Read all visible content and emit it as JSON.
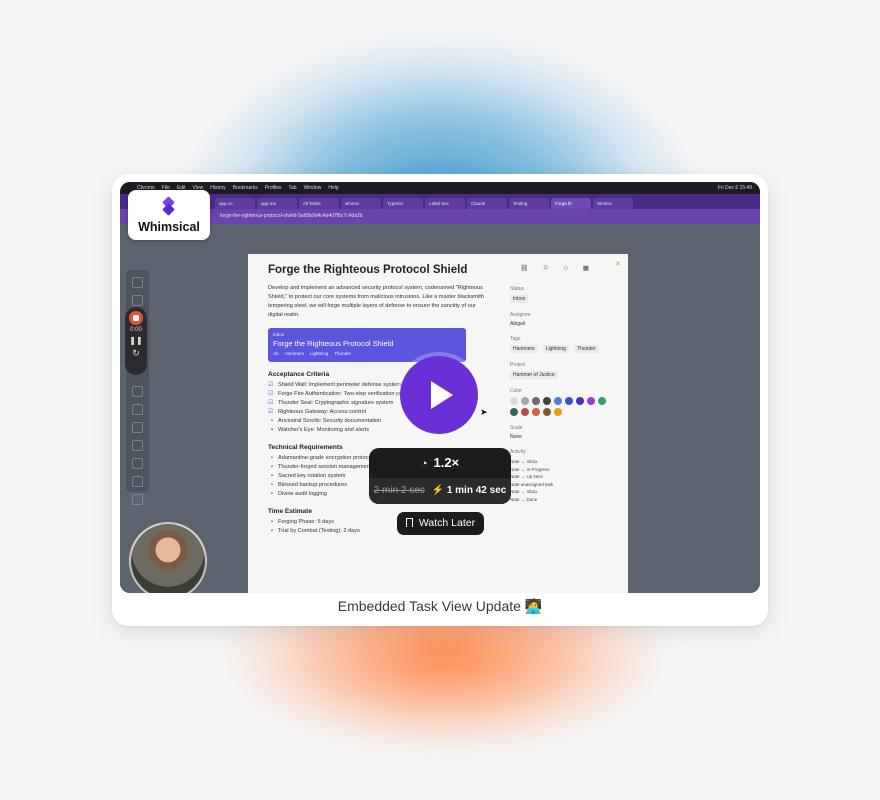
{
  "caption": "Embedded Task View Update 🧑‍💻",
  "logo": {
    "text": "Whimsical"
  },
  "player": {
    "speed": "1.2×",
    "original_duration": "2 min 2 sec",
    "fast_duration": "1 min 42 sec",
    "watch_later_label": "Watch Later",
    "bolt_glyph": "⚡",
    "accent_color": "#6b2fd6"
  },
  "recording": {
    "menubar": [
      "Chrome",
      "File",
      "Edit",
      "View",
      "History",
      "Bookmarks",
      "Profiles",
      "Tab",
      "Window",
      "Help"
    ],
    "menubar_time": "Fri Dec 6 15:49",
    "tabs": [
      "app.co",
      "app.ma",
      "All Tasks",
      "whimsi",
      "TypeScr",
      "Label Sec",
      "Claude",
      "Testing",
      "Forge th",
      "Whimsi"
    ],
    "active_tab_index": 8,
    "url": "forge-the-righteous-protocol-shield-5a65b9d4c4a4d7f5c7c4da2b",
    "rec_timer": "0:00",
    "doc": {
      "title": "Forge the Righteous Protocol Shield",
      "description": "Develop and implement an advanced security protocol system, codenamed \"Righteous Shield,\" to protect our core systems from malicious intrusions. Like a master blacksmith tempering steel, we will forge multiple layers of defense to ensure the sanctity of our digital realm.",
      "embed": {
        "status": "Inbox",
        "title": "Forge the Righteous Protocol Shield",
        "meta": [
          "Ab",
          "Hammers",
          "Lightning",
          "Thunder"
        ]
      },
      "acceptance_heading": "Acceptance Criteria",
      "acceptance": [
        "Shield Wall: Implement perimeter defense system",
        "Forge Fire Authentication: Two-step verification process",
        "Thunder Seal: Cryptographic signature system",
        "Righteous Gateway: Access control",
        "Ancestral Scrolls: Security documentation",
        "Watcher's Eye: Monitoring and alerts"
      ],
      "technical_heading": "Technical Requirements",
      "technical": [
        "Adamantine-grade encryption protocols",
        "Thunder-forged session management",
        "Sacred key rotation system",
        "Blessed backup procedures",
        "Divine audit logging"
      ],
      "time_heading": "Time Estimate",
      "time": [
        "Forging Phase: 5 days",
        "Trial by Combat (Testing): 2 days"
      ]
    },
    "sidebar": {
      "status_label": "Status",
      "status": "Inbox",
      "assignee_label": "Assignee",
      "assignee": "Abigail",
      "tags_label": "Tags",
      "tags": [
        "Hammers",
        "Lightning",
        "Thunder"
      ],
      "project_label": "Project",
      "project": "Hammer of Justice",
      "color_label": "Color",
      "colors": [
        "#d9d9d9",
        "#a7a7a7",
        "#6b6b6b",
        "#3f3f46",
        "#4f7fd8",
        "#3e4fc8",
        "#4b2fbf",
        "#9b3bd6",
        "#3a9b77",
        "#2f6b4f",
        "#b84a4a",
        "#d9603c",
        "#8a5a2b",
        "#e0a01a"
      ],
      "scale_label": "Scale",
      "scale_value": "None",
      "activity_label": "Activity",
      "activity": [
        "Nate → Inbox",
        "Nate → In Progress",
        "Nate → Up Next",
        "Nate unassigned task",
        "Nate → Inbox",
        "Nate → Done"
      ]
    }
  }
}
